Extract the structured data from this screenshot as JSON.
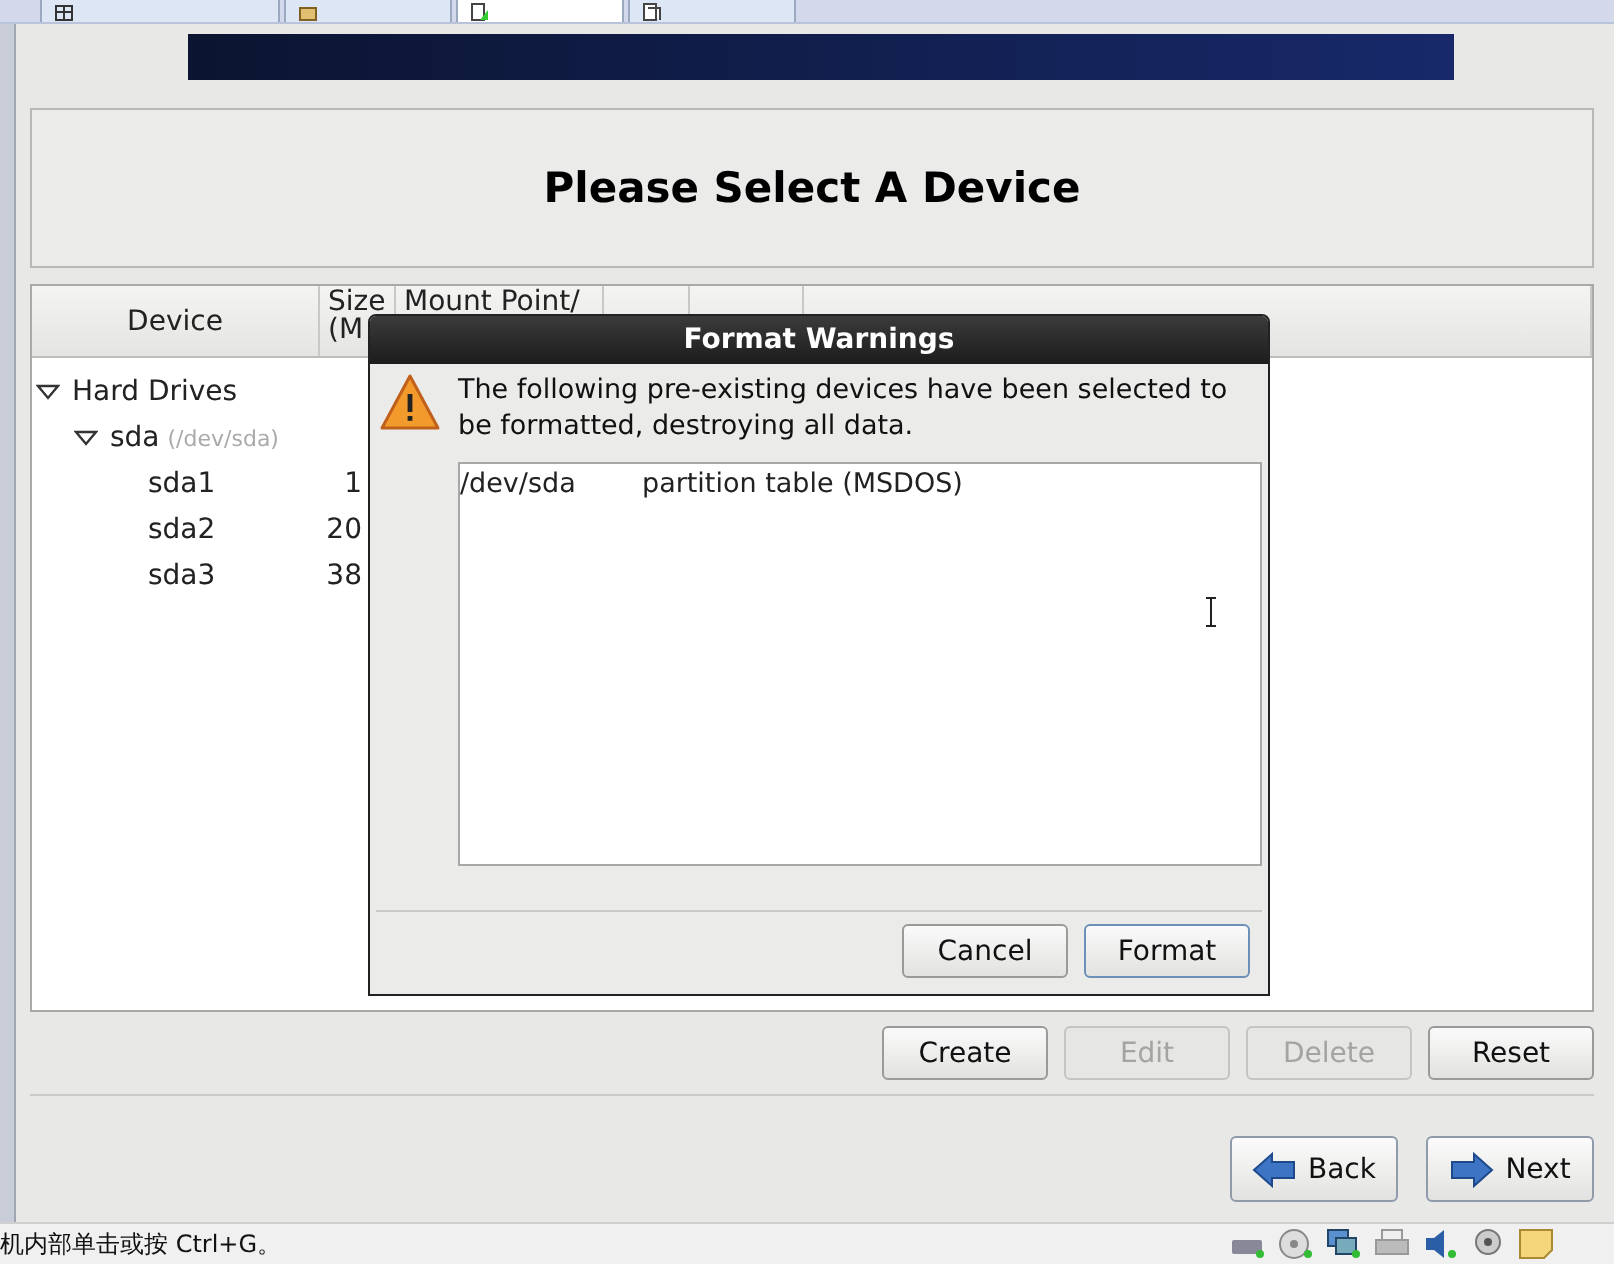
{
  "tabs": [
    {
      "selected": false
    },
    {
      "selected": false
    },
    {
      "selected": true
    },
    {
      "selected": false
    }
  ],
  "heading": "Please Select A Device",
  "table": {
    "columns": [
      {
        "lines": [
          "Device"
        ]
      },
      {
        "lines": [
          "Size",
          "(M"
        ]
      },
      {
        "lines": [
          "Mount Point/"
        ]
      }
    ],
    "rows": [
      {
        "name": "Hard Drives",
        "expanded": true,
        "children": [
          {
            "name": "sda",
            "path": "(/dev/sda)",
            "expanded": true,
            "children": [
              {
                "name": "sda1",
                "size": "1"
              },
              {
                "name": "sda2",
                "size": "20"
              },
              {
                "name": "sda3",
                "size": "38"
              }
            ]
          }
        ]
      }
    ]
  },
  "actions": [
    {
      "label": "Create",
      "disabled": false
    },
    {
      "label": "Edit",
      "disabled": true
    },
    {
      "label": "Delete",
      "disabled": true
    },
    {
      "label": "Reset",
      "disabled": false
    }
  ],
  "nav": [
    {
      "label": "Back",
      "kind": "back"
    },
    {
      "label": "Next",
      "kind": "next"
    }
  ],
  "dialog": {
    "title": "Format Warnings",
    "message": "The following pre-existing devices have been selected to be formatted, destroying all data.",
    "entries": [
      {
        "device": "/dev/sda",
        "description": "partition table (MSDOS)"
      }
    ],
    "buttons": [
      {
        "label": "Cancel",
        "default": false
      },
      {
        "label": "Format",
        "default": true
      }
    ]
  },
  "status_bar": {
    "text": "机内部单击或按 Ctrl+G。"
  }
}
